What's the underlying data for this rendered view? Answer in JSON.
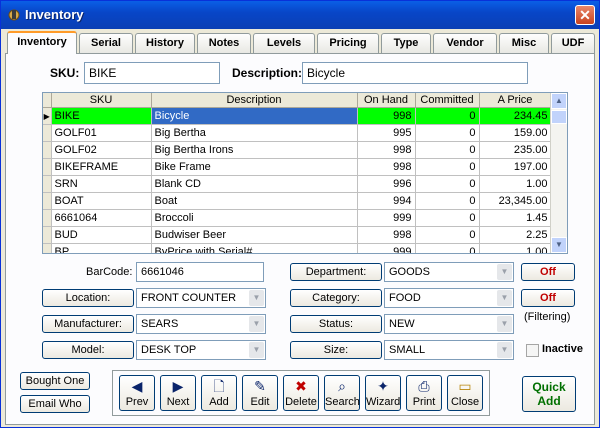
{
  "window": {
    "title": "Inventory",
    "close_label": "✕"
  },
  "tabs": [
    "Inventory",
    "Serial",
    "History",
    "Notes",
    "Levels",
    "Pricing",
    "Type",
    "Vendor",
    "Misc",
    "UDF"
  ],
  "header": {
    "sku_label": "SKU:",
    "sku_value": "BIKE",
    "description_label": "Description:",
    "description_value": "Bicycle"
  },
  "grid": {
    "columns": [
      "SKU",
      "Description",
      "On Hand",
      "Committed",
      "A Price"
    ],
    "rows": [
      {
        "sku": "BIKE",
        "desc": "Bicycle",
        "onhand": "998",
        "committed": "0",
        "aprice": "234.45"
      },
      {
        "sku": "GOLF01",
        "desc": "Big Bertha",
        "onhand": "995",
        "committed": "0",
        "aprice": "159.00"
      },
      {
        "sku": "GOLF02",
        "desc": "Big Bertha Irons",
        "onhand": "998",
        "committed": "0",
        "aprice": "235.00"
      },
      {
        "sku": "BIKEFRAME",
        "desc": "Bike Frame",
        "onhand": "998",
        "committed": "0",
        "aprice": "197.00"
      },
      {
        "sku": "SRN",
        "desc": "Blank CD",
        "onhand": "996",
        "committed": "0",
        "aprice": "1.00"
      },
      {
        "sku": "BOAT",
        "desc": "Boat",
        "onhand": "994",
        "committed": "0",
        "aprice": "23,345.00"
      },
      {
        "sku": "6661064",
        "desc": "Broccoli",
        "onhand": "999",
        "committed": "0",
        "aprice": "1.45"
      },
      {
        "sku": "BUD",
        "desc": "Budwiser Beer",
        "onhand": "998",
        "committed": "0",
        "aprice": "2.25"
      },
      {
        "sku": "BP",
        "desc": "ByPrice with Serial#",
        "onhand": "999",
        "committed": "0",
        "aprice": "1.00"
      }
    ]
  },
  "fields": {
    "barcode_label": "BarCode:",
    "barcode_value": "6661046",
    "location_label": "Location:",
    "location_value": "FRONT COUNTER",
    "manufacturer_label": "Manufacturer:",
    "manufacturer_value": "SEARS",
    "model_label": "Model:",
    "model_value": "DESK TOP",
    "department_label": "Department:",
    "department_value": "GOODS",
    "category_label": "Category:",
    "category_value": "FOOD",
    "status_label": "Status:",
    "status_value": "NEW",
    "size_label": "Size:",
    "size_value": "SMALL",
    "off1_label": "Off",
    "off2_label": "Off",
    "filtering_label": "(Filtering)",
    "inactive_label": "Inactive"
  },
  "left_buttons": {
    "bought_one": "Bought One",
    "email_who": "Email Who"
  },
  "toolbar": {
    "prev": "Prev",
    "next": "Next",
    "add": "Add",
    "edit": "Edit",
    "delete": "Delete",
    "search": "Search",
    "wizard": "Wizard",
    "print": "Print",
    "close": "Close"
  },
  "quick_add": {
    "line1": "Quick",
    "line2": "Add"
  },
  "colors": {
    "selected_green": "#00ff00",
    "selected_blue": "#316ac5",
    "off_red": "#c00000",
    "quick_add_green": "#007000"
  }
}
